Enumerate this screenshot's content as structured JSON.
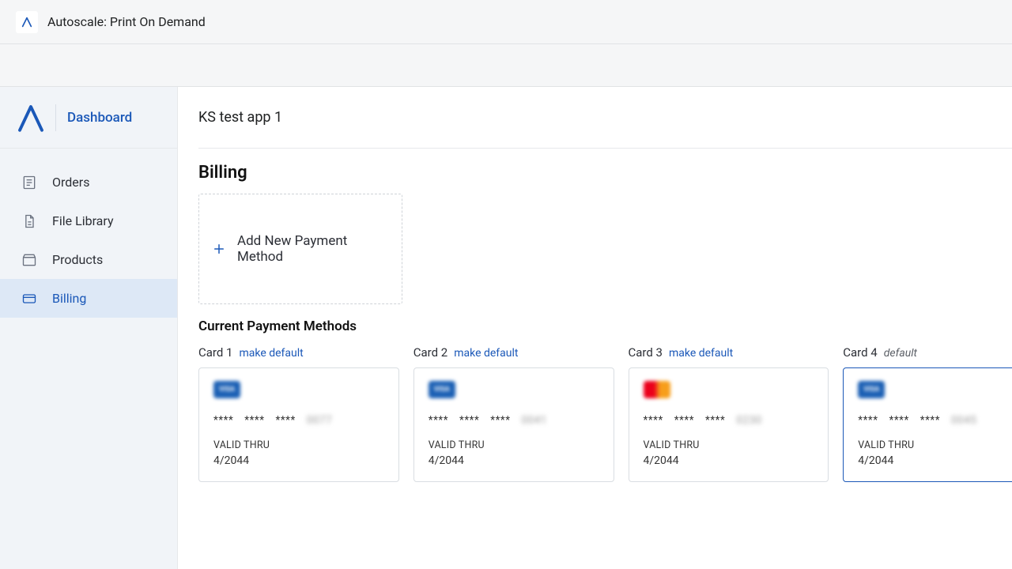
{
  "topbar": {
    "title": "Autoscale: Print On Demand"
  },
  "sidebar": {
    "title": "Dashboard",
    "items": [
      {
        "label": "Orders"
      },
      {
        "label": "File Library"
      },
      {
        "label": "Products"
      },
      {
        "label": "Billing"
      }
    ]
  },
  "main": {
    "app_name": "KS test app 1",
    "section_title": "Billing",
    "add_label": "Add New Payment Method",
    "subsection_title": "Current Payment Methods",
    "make_default_label": "make default",
    "default_label": "default",
    "valid_thru_label": "VALID THRU",
    "masked_group": "****",
    "cards": [
      {
        "title": "Card 1",
        "brand": "visa",
        "last4": "0077",
        "expiry": "4/2044",
        "is_default": false
      },
      {
        "title": "Card 2",
        "brand": "visa",
        "last4": "0041",
        "expiry": "4/2044",
        "is_default": false
      },
      {
        "title": "Card 3",
        "brand": "mc",
        "last4": "0230",
        "expiry": "4/2044",
        "is_default": false
      },
      {
        "title": "Card 4",
        "brand": "visa",
        "last4": "0045",
        "expiry": "4/2044",
        "is_default": true
      }
    ]
  }
}
